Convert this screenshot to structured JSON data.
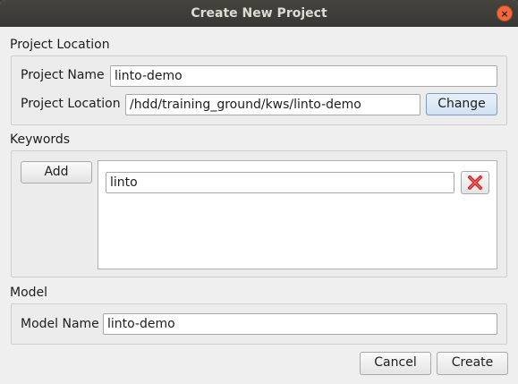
{
  "window": {
    "title": "Create New Project",
    "close_glyph": "×"
  },
  "project_location_section": {
    "heading": "Project Location",
    "project_name_label": "Project Name",
    "project_name_value": "linto-demo",
    "project_location_label": "Project Location",
    "project_location_value": "/hdd/training_ground/kws/linto-demo",
    "change_button": "Change"
  },
  "keywords_section": {
    "heading": "Keywords",
    "add_button": "Add",
    "keywords": [
      {
        "value": "linto",
        "remove_icon": "red-x-icon"
      }
    ]
  },
  "model_section": {
    "heading": "Model",
    "model_name_label": "Model Name",
    "model_name_value": "linto-demo"
  },
  "footer": {
    "cancel_button": "Cancel",
    "create_button": "Create"
  },
  "colors": {
    "title_bar": "#3e3d39",
    "close_button": "#f0693d",
    "dialog_bg": "#efefef",
    "remove_icon": "#d42a2a"
  }
}
